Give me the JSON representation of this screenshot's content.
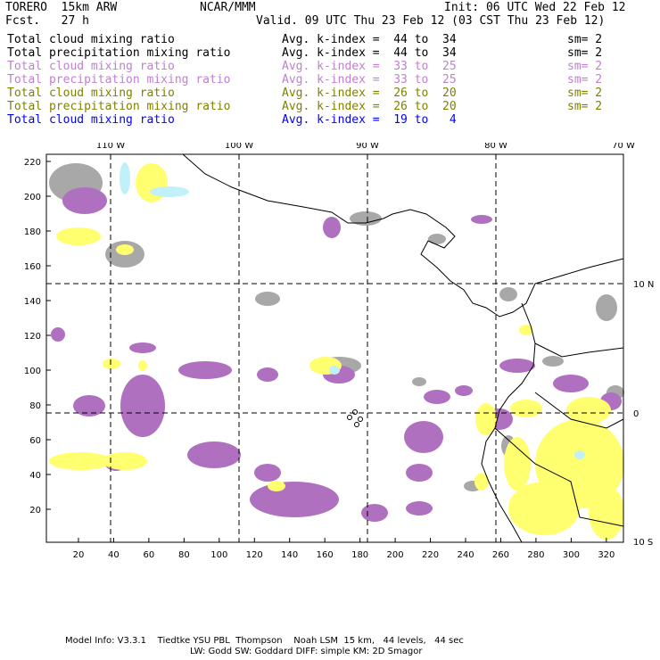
{
  "header": {
    "model": "TORERO  15km ARW",
    "org": "NCAR/MMM",
    "init": "Init: 06 UTC Wed 22 Feb 12",
    "fcst": "Fcst.   27 h",
    "valid": "Valid. 09 UTC Thu 23 Feb 12 (03 CST Thu 23 Feb 12)"
  },
  "legend": [
    {
      "field": "Total cloud mixing ratio",
      "range": "Avg. k-index =  44 to  34",
      "sm": "sm= 2",
      "color": "#000000"
    },
    {
      "field": "Total precipitation mixing ratio",
      "range": "Avg. k-index =  44 to  34",
      "sm": "sm= 2",
      "color": "#000000"
    },
    {
      "field": "Total cloud mixing ratio",
      "range": "Avg. k-index =  33 to  25",
      "sm": "sm= 2",
      "color": "#c080d0"
    },
    {
      "field": "Total precipitation mixing ratio",
      "range": "Avg. k-index =  33 to  25",
      "sm": "sm= 2",
      "color": "#c080d0"
    },
    {
      "field": "Total cloud mixing ratio",
      "range": "Avg. k-index =  26 to  20",
      "sm": "sm= 2",
      "color": "#808000"
    },
    {
      "field": "Total precipitation mixing ratio",
      "range": "Avg. k-index =  26 to  20",
      "sm": "sm= 2",
      "color": "#808000"
    },
    {
      "field": "Total cloud mixing ratio",
      "range": "Avg. k-index =  19 to   4",
      "sm": "",
      "color": "#0000ff"
    }
  ],
  "axes": {
    "top": [
      "110 W",
      "100 W",
      "90 W",
      "80 W",
      "70 W"
    ],
    "right": [
      "10 N",
      "0",
      "10 S"
    ],
    "bottom": [
      "20",
      "40",
      "60",
      "80",
      "100",
      "120",
      "140",
      "160",
      "180",
      "200",
      "220",
      "240",
      "260",
      "280",
      "300",
      "320"
    ],
    "left": [
      "20",
      "40",
      "60",
      "80",
      "100",
      "120",
      "140",
      "160",
      "180",
      "200",
      "220"
    ]
  },
  "colors": {
    "gray": "#a8a8a8",
    "purple": "#b070c0",
    "yellow": "#ffff70",
    "lightblue": "#c0f0f8"
  },
  "footer": {
    "line1": "Model Info: V3.3.1    Tiedtke YSU PBL  Thompson    Noah LSM  15 km,   44 levels,   44 sec",
    "line2": "LW: Godd SW: Goddard DIFF: simple KM: 2D Smagor"
  }
}
